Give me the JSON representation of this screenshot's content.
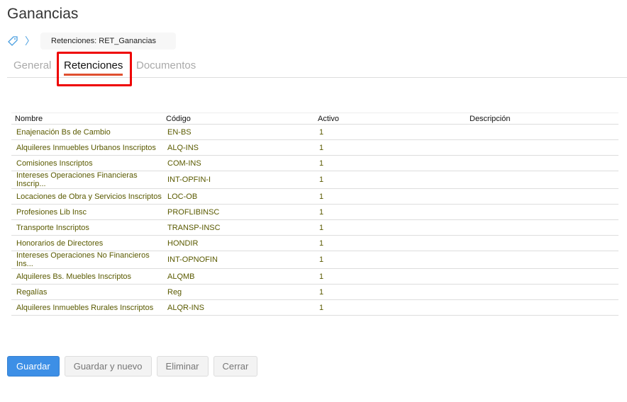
{
  "title": "Ganancias",
  "breadcrumb": {
    "icon": "tag-icon",
    "current": "Retenciones: RET_Ganancias"
  },
  "tabs": [
    {
      "label": "General"
    },
    {
      "label": "Retenciones",
      "active": true
    },
    {
      "label": "Documentos"
    }
  ],
  "table": {
    "headers": [
      "Nombre",
      "Código",
      "Activo",
      "Descripción"
    ],
    "rows": [
      [
        "Enajenación Bs de Cambio",
        "EN-BS",
        "1",
        ""
      ],
      [
        "Alquileres Inmuebles Urbanos Inscriptos",
        "ALQ-INS",
        "1",
        ""
      ],
      [
        "Comisiones Inscriptos",
        "COM-INS",
        "1",
        ""
      ],
      [
        "Intereses Operaciones Financieras Inscrip...",
        "INT-OPFIN-I",
        "1",
        ""
      ],
      [
        "Locaciones de Obra y Servicios Inscriptos",
        "LOC-OB",
        "1",
        ""
      ],
      [
        "Profesiones Lib Insc",
        "PROFLIBINSC",
        "1",
        ""
      ],
      [
        "Transporte Inscriptos",
        "TRANSP-INSC",
        "1",
        ""
      ],
      [
        "Honorarios de Directores",
        "HONDIR",
        "1",
        ""
      ],
      [
        "Intereses Operaciones No Financieros Ins...",
        "INT-OPNOFIN",
        "1",
        ""
      ],
      [
        "Alquileres Bs. Muebles Inscriptos",
        "ALQMB",
        "1",
        ""
      ],
      [
        "Regalías",
        "Reg",
        "1",
        ""
      ],
      [
        "Alquileres Inmuebles Rurales Inscriptos",
        "ALQR-INS",
        "1",
        ""
      ]
    ]
  },
  "buttons": {
    "save": "Guardar",
    "save_new": "Guardar y nuevo",
    "delete": "Eliminar",
    "close": "Cerrar"
  },
  "colors": {
    "primary": "#3d8fe6",
    "active_tab": "#e05030",
    "highlight": "#ee0000"
  }
}
